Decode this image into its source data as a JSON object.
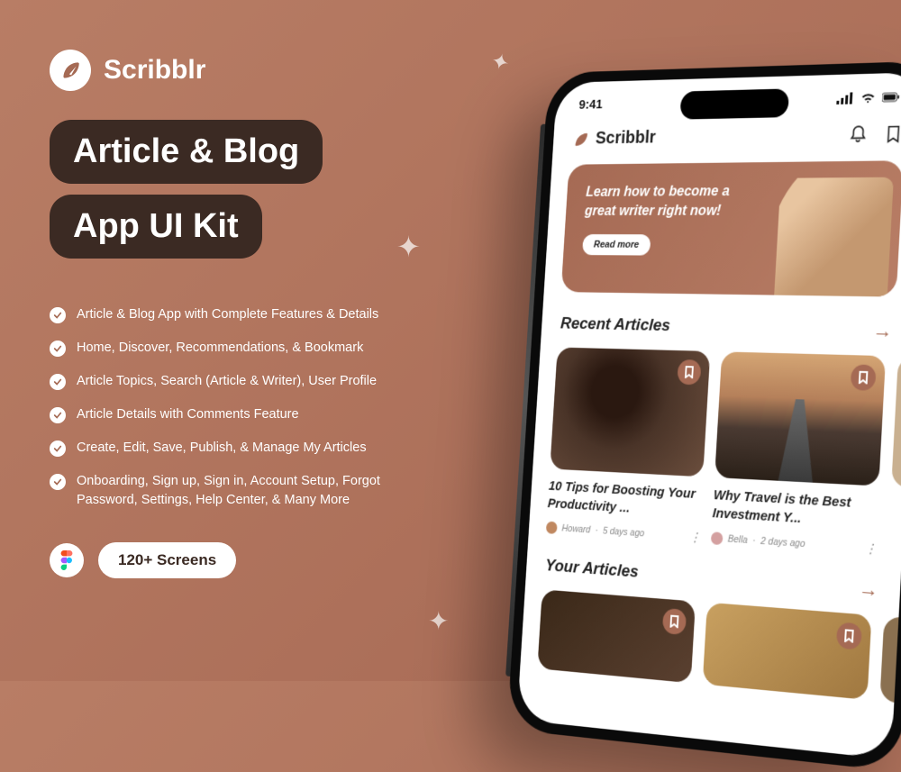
{
  "brand": "Scribblr",
  "title_line1": "Article & Blog",
  "title_line2": "App UI Kit",
  "features": [
    "Article & Blog App with Complete Features & Details",
    "Home, Discover, Recommendations, & Bookmark",
    "Article Topics, Search (Article & Writer), User Profile",
    "Article Details with Comments Feature",
    "Create, Edit, Save, Publish, & Manage My Articles",
    "Onboarding, Sign up, Sign in, Account Setup, Forgot Password, Settings, Help Center, & Many More"
  ],
  "screens_badge": "120+ Screens",
  "phone": {
    "time": "9:41",
    "app_name": "Scribblr",
    "hero": {
      "text": "Learn how to become a great writer right now!",
      "button": "Read more"
    },
    "sections": {
      "recent": "Recent Articles",
      "your": "Your Articles",
      "arrow": "→"
    },
    "articles": [
      {
        "title": "10 Tips for Boosting Your Productivity ...",
        "author": "Howard",
        "age": "5 days ago"
      },
      {
        "title": "Why Travel is the Best Investment Y...",
        "author": "Bella",
        "age": "2 days ago"
      }
    ]
  }
}
